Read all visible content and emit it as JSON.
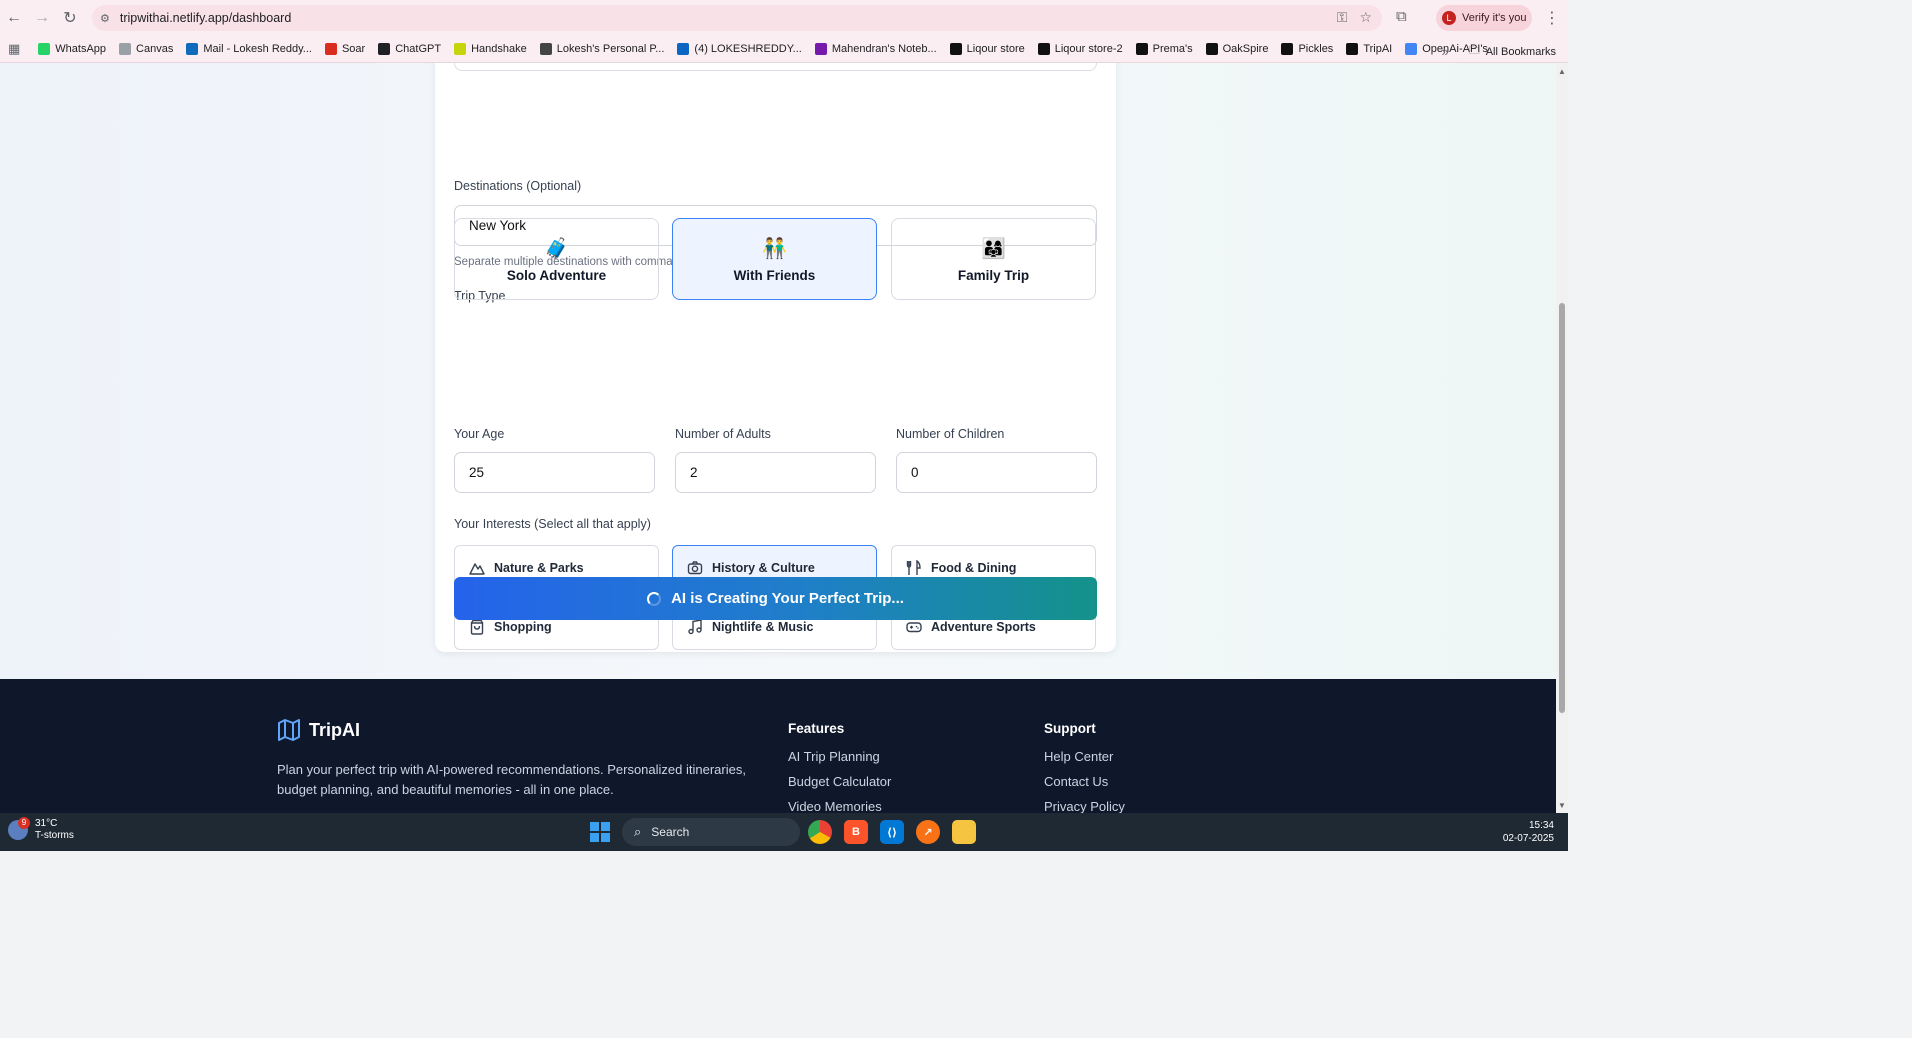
{
  "browser": {
    "url": "tripwithai.netlify.app/dashboard",
    "profile_label": "Verify it's you",
    "profile_initial": "L",
    "bookmarks": [
      {
        "label": "WhatsApp",
        "icon": "whatsapp-icon",
        "color": "#25d366"
      },
      {
        "label": "Canvas",
        "icon": "canvas-icon",
        "color": "#9aa0a6"
      },
      {
        "label": "Mail - Lokesh Reddy...",
        "icon": "outlook-icon",
        "color": "#0f6cbd"
      },
      {
        "label": "Soar",
        "icon": "soar-icon",
        "color": "#d92d20"
      },
      {
        "label": "ChatGPT",
        "icon": "chatgpt-icon",
        "color": "#202124"
      },
      {
        "label": "Handshake",
        "icon": "handshake-icon",
        "color": "#c6d40c"
      },
      {
        "label": "Lokesh's Personal P...",
        "icon": "globe-icon",
        "color": "#444"
      },
      {
        "label": "(4) LOKESHREDDY...",
        "icon": "linkedin-icon",
        "color": "#0a66c2"
      },
      {
        "label": "Mahendran's Noteb...",
        "icon": "onenote-icon",
        "color": "#7719aa"
      },
      {
        "label": "Liqour store",
        "icon": "bolt-icon",
        "color": "#111"
      },
      {
        "label": "Liqour store-2",
        "icon": "bolt-icon",
        "color": "#111"
      },
      {
        "label": "Prema's",
        "icon": "bolt-icon",
        "color": "#111"
      },
      {
        "label": "OakSpire",
        "icon": "bolt-icon",
        "color": "#111"
      },
      {
        "label": "Pickles",
        "icon": "bolt-icon",
        "color": "#111"
      },
      {
        "label": "TripAI",
        "icon": "bolt-icon",
        "color": "#111"
      },
      {
        "label": "OpenAi-API's",
        "icon": "globe-icon",
        "color": "#4285f4"
      }
    ],
    "all_bookmarks_label": "All Bookmarks",
    "overflow_glyph": "»"
  },
  "form": {
    "destinations_label": "Destinations (Optional)",
    "destinations_value": "New York",
    "destinations_hint": "Separate multiple destinations with commas",
    "trip_type_label": "Trip Type",
    "trip_types": [
      {
        "label": "Solo Adventure",
        "emoji": "🧳",
        "selected": false
      },
      {
        "label": "With Friends",
        "emoji": "👬",
        "selected": true
      },
      {
        "label": "Family Trip",
        "emoji": "👨‍👩‍👧",
        "selected": false
      }
    ],
    "age_label": "Your Age",
    "age_value": "25",
    "adults_label": "Number of Adults",
    "adults_value": "2",
    "children_label": "Number of Children",
    "children_value": "0",
    "interests_label": "Your Interests (Select all that apply)",
    "interests": [
      {
        "label": "Nature & Parks",
        "icon": "mountain-icon",
        "selected": false
      },
      {
        "label": "History & Culture",
        "icon": "camera-icon",
        "selected": true
      },
      {
        "label": "Food & Dining",
        "icon": "utensils-icon",
        "selected": false
      },
      {
        "label": "Shopping",
        "icon": "shopping-bag-icon",
        "selected": false
      },
      {
        "label": "Nightlife & Music",
        "icon": "music-icon",
        "selected": false
      },
      {
        "label": "Adventure Sports",
        "icon": "gamepad-icon",
        "selected": false
      }
    ],
    "submit_label": "AI is Creating Your Perfect Trip..."
  },
  "footer": {
    "brand": "TripAI",
    "description": "Plan your perfect trip with AI-powered recommendations. Personalized itineraries, budget planning, and beautiful memories - all in one place.",
    "features_title": "Features",
    "features": [
      "AI Trip Planning",
      "Budget Calculator",
      "Video Memories"
    ],
    "support_title": "Support",
    "support": [
      "Help Center",
      "Contact Us",
      "Privacy Policy"
    ]
  },
  "taskbar": {
    "temperature": "31°C",
    "weather": "T-storms",
    "weather_badge": "9",
    "search_label": "Search",
    "time": "15:34",
    "date": "02-07-2025"
  },
  "colors": {
    "accent": "#3b82f6",
    "cta_start": "#2563eb",
    "cta_end": "#14928a",
    "footer_bg": "#0f172a"
  }
}
